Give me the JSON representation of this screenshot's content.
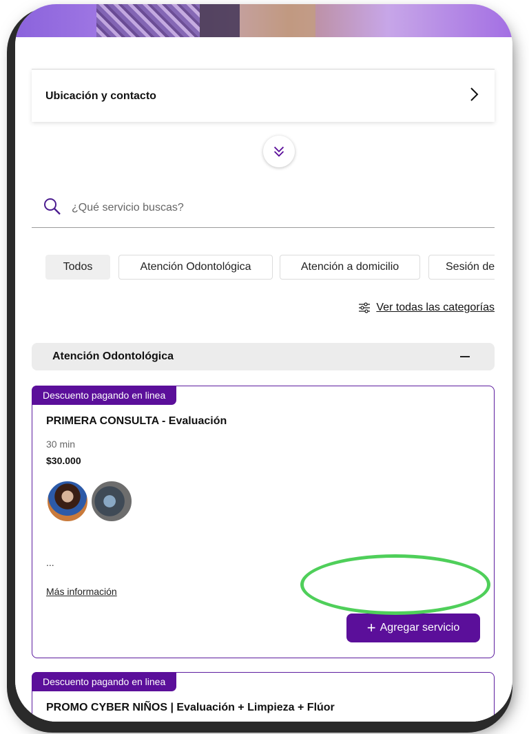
{
  "contact": {
    "title": "Ubicación y contacto"
  },
  "search": {
    "placeholder": "¿Qué servicio buscas?"
  },
  "chips": [
    {
      "label": "Todos",
      "active": true
    },
    {
      "label": "Atención Odontológica",
      "active": false
    },
    {
      "label": "Atención a domicilio",
      "active": false
    },
    {
      "label": "Sesión de",
      "active": false
    }
  ],
  "view_all_label": "Ver todas las categorías",
  "category": {
    "title": "Atención Odontológica"
  },
  "services": [
    {
      "badge": "Descuento pagando en linea",
      "title": "PRIMERA CONSULTA - Evaluación",
      "duration": "30 min",
      "price": "$30.000",
      "description": "...",
      "more_label": "Más información",
      "add_label": "Agregar servicio"
    },
    {
      "badge": "Descuento pagando en linea",
      "title": "PROMO CYBER NIÑOS | Evaluación + Limpieza + Flúor"
    }
  ],
  "colors": {
    "accent": "#5b0f9a",
    "highlight": "#4fcf5a"
  },
  "icons": [
    "chevron-right-icon",
    "double-chevron-down-icon",
    "search-icon",
    "filter-sliders-icon",
    "minus-icon",
    "plus-icon"
  ]
}
